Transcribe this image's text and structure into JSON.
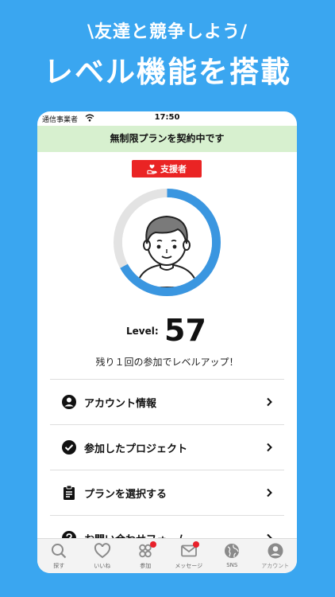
{
  "promo": {
    "sub_headline": "\\友達と競争しよう/",
    "main_headline": "レベル機能を搭載"
  },
  "status_bar": {
    "carrier": "通信事業者",
    "time": "17:50"
  },
  "plan_banner": "無制限プランを契約中です",
  "badge": {
    "label": "支援者",
    "color": "#ea2424"
  },
  "level": {
    "label": "Level:",
    "value": "57",
    "progress": 0.67,
    "progress_color": "#3a96e0",
    "hint": "残り１回の参加でレベルアップ！"
  },
  "menu": {
    "items": [
      {
        "label": "アカウント情報",
        "icon": "account-circle-icon"
      },
      {
        "label": "参加したプロジェクト",
        "icon": "check-circle-icon"
      },
      {
        "label": "プランを選択する",
        "icon": "clipboard-icon"
      },
      {
        "label": "お問い合わせフォーム",
        "icon": "help-circle-icon"
      }
    ]
  },
  "tabs": [
    {
      "label": "探す",
      "icon": "search-icon",
      "notification": false
    },
    {
      "label": "いいね",
      "icon": "heart-icon",
      "notification": false
    },
    {
      "label": "参加",
      "icon": "people-icon",
      "notification": true
    },
    {
      "label": "メッセージ",
      "icon": "mail-icon",
      "notification": true
    },
    {
      "label": "SNS",
      "icon": "globe-icon",
      "notification": false
    },
    {
      "label": "アカウント",
      "icon": "account-icon",
      "notification": false,
      "active": true
    }
  ],
  "colors": {
    "background": "#3aa6f0",
    "banner": "#d7f0cf",
    "notification": "#e8202a"
  }
}
